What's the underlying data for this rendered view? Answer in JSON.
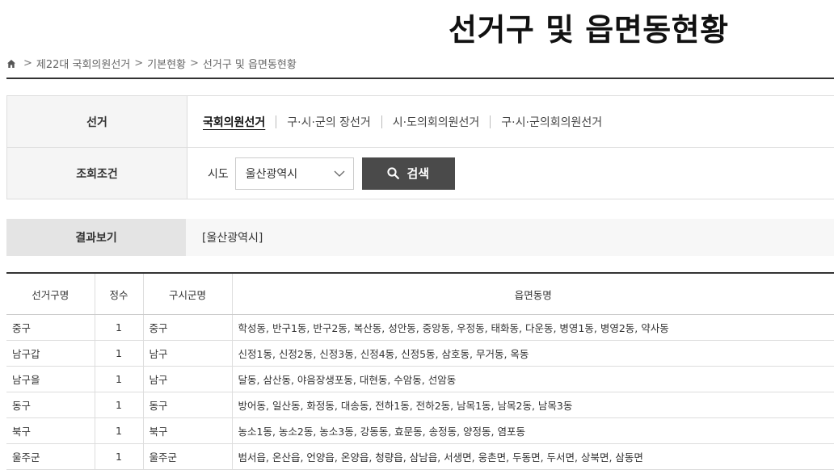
{
  "page": {
    "title": "선거구 및 읍면동현황"
  },
  "breadcrumb": [
    "제22대 국회의원선거",
    "기본현황",
    "선거구 및 읍면동현황"
  ],
  "filter": {
    "election_label": "선거",
    "tabs": [
      {
        "label": "국회의원선거",
        "active": true
      },
      {
        "label": "구·시·군의 장선거",
        "active": false
      },
      {
        "label": "시·도의회의원선거",
        "active": false
      },
      {
        "label": "구·시·군의회의원선거",
        "active": false
      }
    ],
    "condition_label": "조회조건",
    "sido_label": "시도",
    "sido_value": "울산광역시",
    "search_label": "검색"
  },
  "result": {
    "label": "결과보기",
    "value": "[울산광역시]"
  },
  "table": {
    "headers": [
      "선거구명",
      "정수",
      "구시군명",
      "읍면동명"
    ],
    "rows": [
      [
        "중구",
        "1",
        "중구",
        "학성동, 반구1동, 반구2동, 복산동, 성안동, 중앙동, 우정동, 태화동, 다운동, 병영1동, 병영2동, 약사동"
      ],
      [
        "남구갑",
        "1",
        "남구",
        "신정1동, 신정2동, 신정3동, 신정4동, 신정5동, 삼호동, 무거동, 옥동"
      ],
      [
        "남구을",
        "1",
        "남구",
        "달동, 삼산동, 야음장생포동, 대현동, 수암동, 선암동"
      ],
      [
        "동구",
        "1",
        "동구",
        "방어동, 일산동, 화정동, 대송동, 전하1동, 전하2동, 남목1동, 남목2동, 남목3동"
      ],
      [
        "북구",
        "1",
        "북구",
        "농소1동, 농소2동, 농소3동, 강동동, 효문동, 송정동, 양정동, 염포동"
      ],
      [
        "울주군",
        "1",
        "울주군",
        "범서읍, 온산읍, 언양읍, 온양읍, 청량읍, 삼남읍, 서생면, 웅촌면, 두동면, 두서면, 상북면, 삼동면"
      ]
    ]
  }
}
